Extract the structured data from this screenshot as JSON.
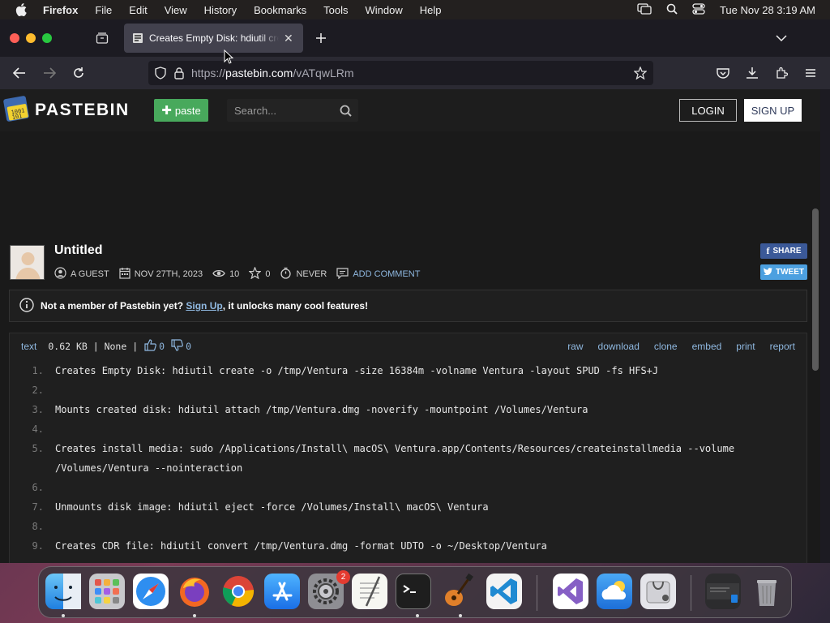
{
  "menubar": {
    "app": "Firefox",
    "items": [
      "File",
      "Edit",
      "View",
      "History",
      "Bookmarks",
      "Tools",
      "Window",
      "Help"
    ],
    "clock": "Tue Nov 28  3:19 AM"
  },
  "browser": {
    "tab_title": "Creates Empty Disk: hdiutil create",
    "url_prefix": "https://",
    "url_host": "pastebin.com",
    "url_path": "/vATqwLRm"
  },
  "pastebin": {
    "logo": "PASTEBIN",
    "paste_button": "paste",
    "search_placeholder": "Search...",
    "login": "LOGIN",
    "signup": "SIGN UP",
    "title": "Untitled",
    "author": "A GUEST",
    "date": "NOV 27TH, 2023",
    "views": "10",
    "stars": "0",
    "expires": "NEVER",
    "add_comment": "ADD COMMENT",
    "share": "SHARE",
    "tweet": "TWEET",
    "notice_prefix": "Not a member of Pastebin yet?",
    "notice_link": "Sign Up",
    "notice_suffix": ", it unlocks many cool features!",
    "syntax": "text",
    "size_info": "0.62 KB | None |",
    "likes": "0",
    "dislikes": "0",
    "actions": [
      "raw",
      "download",
      "clone",
      "embed",
      "print",
      "report"
    ]
  },
  "code_lines": [
    {
      "num": "1.",
      "text": "Creates Empty Disk: hdiutil create -o /tmp/Ventura -size 16384m -volname Ventura -layout SPUD -fs HFS+J"
    },
    {
      "num": "2.",
      "text": ""
    },
    {
      "num": "3.",
      "text": "Mounts created disk: hdiutil attach /tmp/Ventura.dmg -noverify -mountpoint /Volumes/Ventura"
    },
    {
      "num": "4.",
      "text": ""
    },
    {
      "num": "5.",
      "text": "Creates install media: sudo /Applications/Install\\ macOS\\ Ventura.app/Contents/Resources/createinstallmedia --volume /Volumes/Ventura --nointeraction"
    },
    {
      "num": "6.",
      "text": ""
    },
    {
      "num": "7.",
      "text": "Unmounts disk image: hdiutil eject -force /Volumes/Install\\ macOS\\ Ventura"
    },
    {
      "num": "8.",
      "text": ""
    },
    {
      "num": "9.",
      "text": "Creates CDR file: hdiutil convert /tmp/Ventura.dmg -format UDTO -o ~/Desktop/Ventura"
    }
  ],
  "dock": {
    "settings_badge": "2",
    "apps": [
      "Finder",
      "Launchpad",
      "Safari",
      "Firefox",
      "Chrome",
      "App Store",
      "System Settings",
      "TextEdit",
      "Terminal",
      "GarageBand",
      "Visual Studio Code",
      "Visual Studio",
      "iCloud",
      "Disk Utility",
      "Screen",
      "Trash"
    ]
  }
}
